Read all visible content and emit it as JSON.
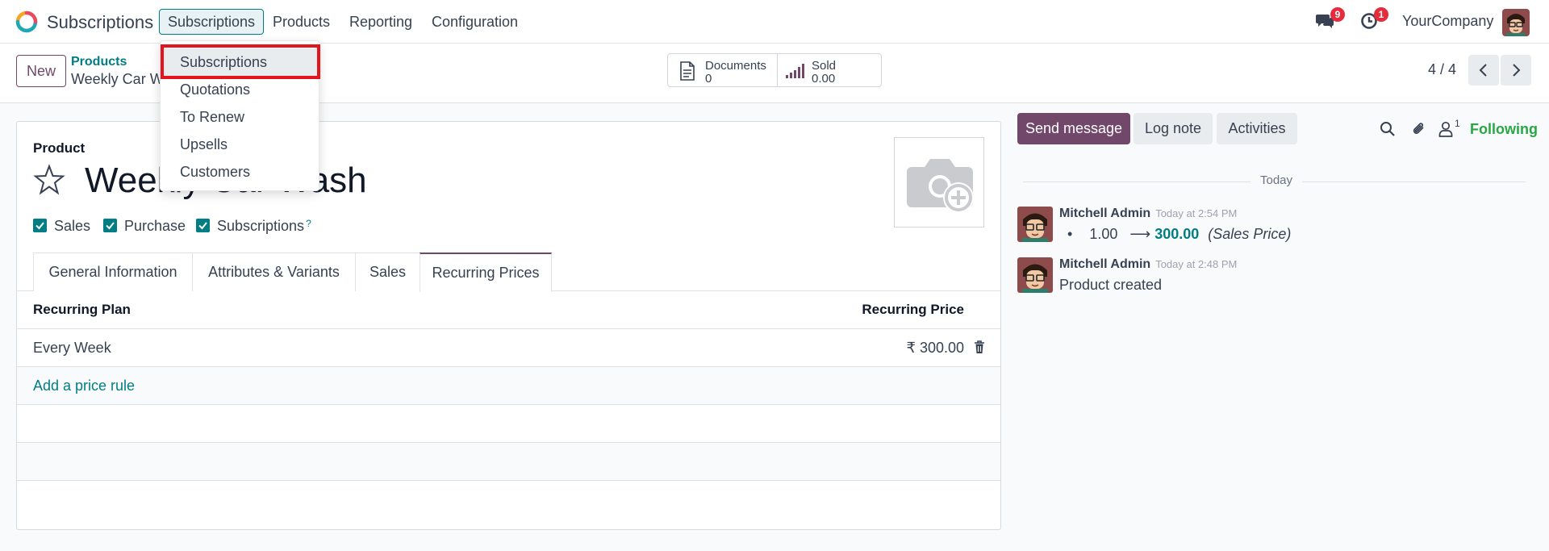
{
  "navbar": {
    "app_name": "Subscriptions",
    "menu": [
      "Subscriptions",
      "Products",
      "Reporting",
      "Configuration"
    ],
    "messages_badge": "9",
    "activities_badge": "1",
    "company": "YourCompany"
  },
  "dropdown": {
    "items": [
      "Subscriptions",
      "Quotations",
      "To Renew",
      "Upsells",
      "Customers"
    ]
  },
  "control": {
    "new_label": "New",
    "breadcrumb_parent": "Products",
    "breadcrumb_current": "Weekly Car Wash",
    "documents_label": "Documents",
    "documents_value": "0",
    "sold_label": "Sold",
    "sold_value": "0.00",
    "pager": "4 / 4"
  },
  "form": {
    "product_label": "Product",
    "product_name": "Weekly Car Wash",
    "checkboxes": [
      "Sales",
      "Purchase",
      "Subscriptions"
    ],
    "help_mark": "?",
    "tabs": [
      "General Information",
      "Attributes & Variants",
      "Sales",
      "Recurring Prices"
    ],
    "grid": {
      "col_plan": "Recurring Plan",
      "col_price": "Recurring Price",
      "rows": [
        {
          "plan": "Every Week",
          "price": "₹ 300.00"
        }
      ],
      "add_label": "Add a price rule"
    }
  },
  "chatter": {
    "send_message": "Send message",
    "log_note": "Log note",
    "activities": "Activities",
    "followers_count": "1",
    "following": "Following",
    "date_separator": "Today",
    "messages": [
      {
        "author": "Mitchell Admin",
        "time": "Today at 2:54 PM",
        "old_value": "1.00",
        "new_value": "300.00",
        "field": "(Sales Price)"
      },
      {
        "author": "Mitchell Admin",
        "time": "Today at 2:48 PM",
        "body": "Product created"
      }
    ]
  },
  "colors": {
    "primary": "#71476a",
    "accent": "#017e84",
    "badge": "#e52b3c",
    "highlight": "#e5141c"
  }
}
